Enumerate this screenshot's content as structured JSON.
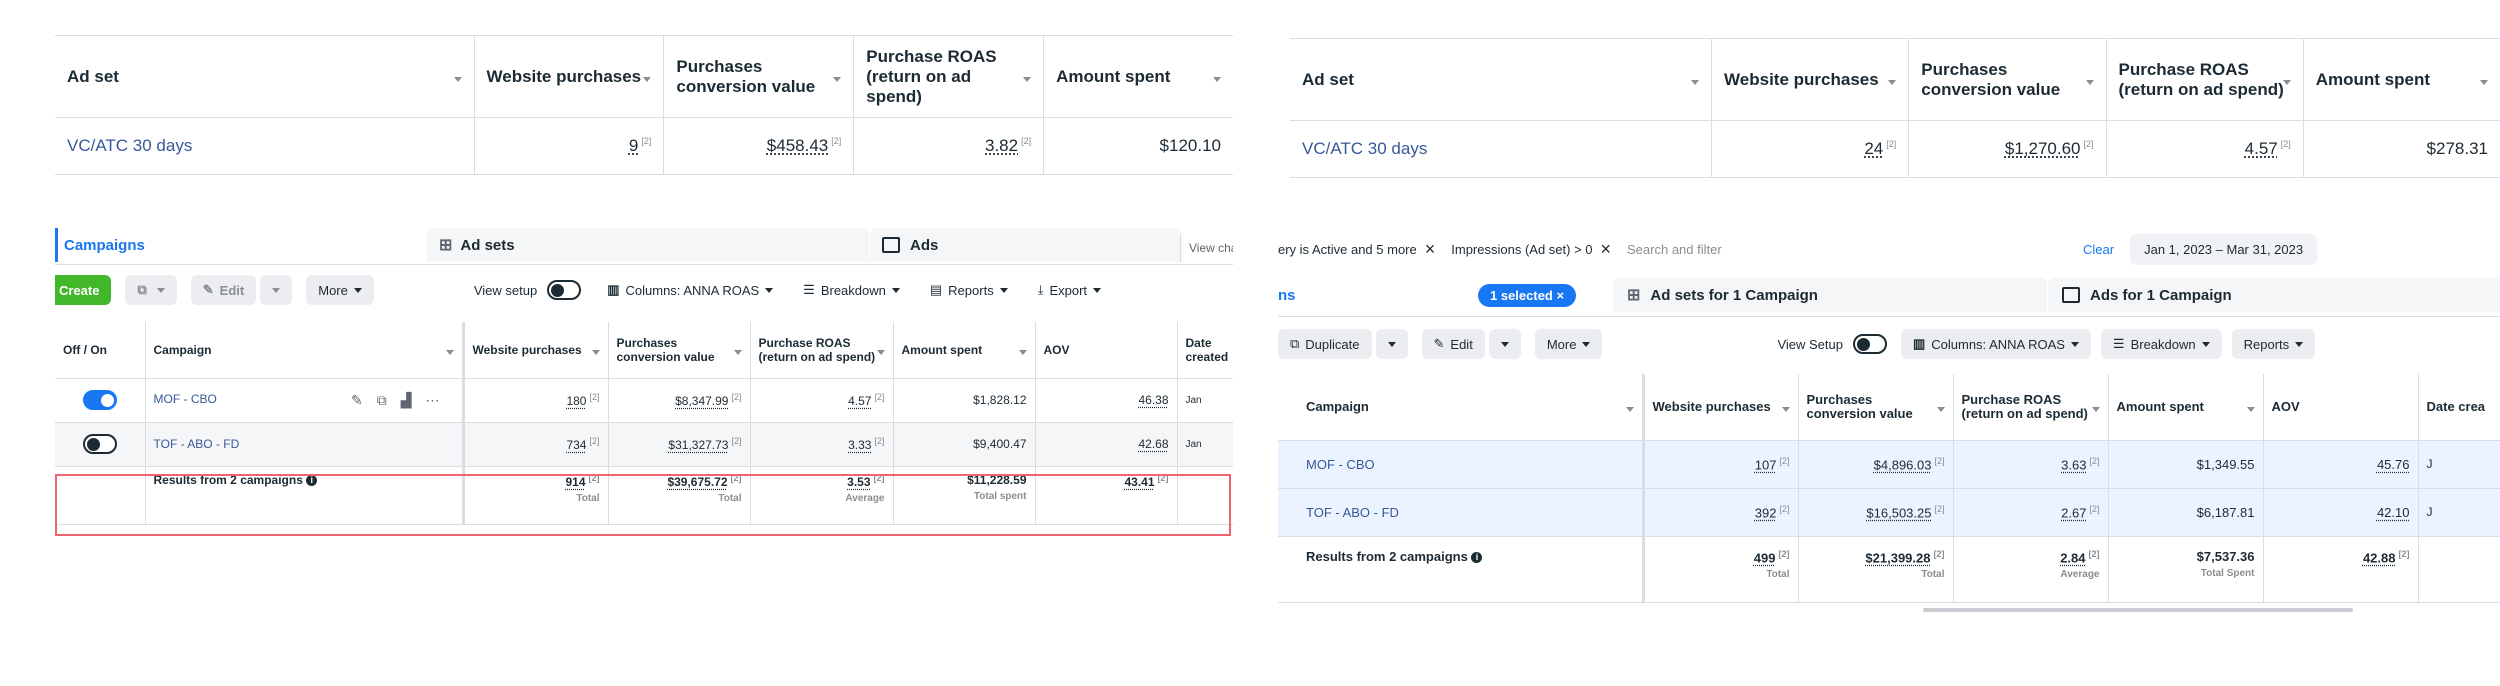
{
  "colors": {
    "link": "#385898",
    "accent": "#1877f2",
    "green": "#42b72a",
    "highlight": "#f06372"
  },
  "top_left": {
    "headers": [
      "Ad set",
      "Website purchases",
      "Purchases conversion value",
      "Purchase ROAS (return on ad spend)",
      "Amount spent"
    ],
    "row": {
      "name": "VC/ATC 30 days",
      "purchases": "9",
      "value": "$458.43",
      "roas": "3.82",
      "spent": "$120.10",
      "ref": "[2]"
    }
  },
  "top_right": {
    "headers": [
      "Ad set",
      "Website purchases",
      "Purchases conversion value",
      "Purchase ROAS (return on ad spend)",
      "Amount spent"
    ],
    "row": {
      "name": "VC/ATC 30 days",
      "purchases": "24",
      "value": "$1,270.60",
      "roas": "4.57",
      "spent": "$278.31",
      "ref": "[2]"
    }
  },
  "left_panel": {
    "tabs": {
      "campaigns": "Campaigns",
      "adsets": "Ad sets",
      "ads": "Ads",
      "view_charts": "View charts (C"
    },
    "toolbar": {
      "create": "Create",
      "edit": "Edit",
      "more": "More",
      "view_setup": "View setup",
      "columns": "Columns: ANNA ROAS",
      "breakdown": "Breakdown",
      "reports": "Reports",
      "export": "Export"
    },
    "headers": {
      "offon": "Off / On",
      "campaign": "Campaign",
      "purchases": "Website purchases",
      "value": "Purchases conversion value",
      "roas": "Purchase ROAS (return on ad spend)",
      "spent": "Amount spent",
      "aov": "AOV",
      "date": "Date created"
    },
    "rows": [
      {
        "name": "MOF - CBO",
        "purchases": "180",
        "value": "$8,347.99",
        "roas": "4.57",
        "spent": "$1,828.12",
        "aov": "46.38",
        "date": "Jan",
        "on": true
      },
      {
        "name": "TOF - ABO - FD",
        "purchases": "734",
        "value": "$31,327.73",
        "roas": "3.33",
        "spent": "$9,400.47",
        "aov": "42.68",
        "date": "Jan",
        "on": false
      }
    ],
    "results": {
      "label": "Results from 2 campaigns",
      "purchases": "914",
      "value": "$39,675.72",
      "roas": "3.53",
      "spent": "$11,228.59",
      "aov": "43.41",
      "sub_total": "Total",
      "sub_avg": "Average",
      "sub_spent": "Total spent"
    },
    "ref": "[2]"
  },
  "right_panel": {
    "filters": {
      "status": "ery is Active and 5 more",
      "impressions": "Impressions (Ad set) > 0",
      "search": "Search and filter",
      "clear": "Clear",
      "dates": "Jan 1, 2023 – Mar 31, 2023"
    },
    "tabs": {
      "campaigns": "ns",
      "selected": "1 selected",
      "adsets": "Ad sets for 1 Campaign",
      "ads": "Ads for 1 Campaign"
    },
    "toolbar": {
      "duplicate": "Duplicate",
      "edit": "Edit",
      "more": "More",
      "view_setup": "View Setup",
      "columns": "Columns: ANNA ROAS",
      "breakdown": "Breakdown",
      "reports": "Reports"
    },
    "headers": {
      "campaign": "Campaign",
      "purchases": "Website purchases",
      "value": "Purchases conversion value",
      "roas": "Purchase ROAS (return on ad spend)",
      "spent": "Amount spent",
      "aov": "AOV",
      "date": "Date crea"
    },
    "rows": [
      {
        "name": "MOF - CBO",
        "purchases": "107",
        "value": "$4,896.03",
        "roas": "3.63",
        "spent": "$1,349.55",
        "aov": "45.76",
        "date": "J"
      },
      {
        "name": "TOF - ABO - FD",
        "purchases": "392",
        "value": "$16,503.25",
        "roas": "2.67",
        "spent": "$6,187.81",
        "aov": "42.10",
        "date": "J"
      }
    ],
    "results": {
      "label": "Results from 2 campaigns",
      "purchases": "499",
      "value": "$21,399.28",
      "roas": "2.84",
      "spent": "$7,537.36",
      "aov": "42.88",
      "sub_total": "Total",
      "sub_avg": "Average",
      "sub_spent": "Total Spent"
    },
    "ref": "[2]"
  }
}
